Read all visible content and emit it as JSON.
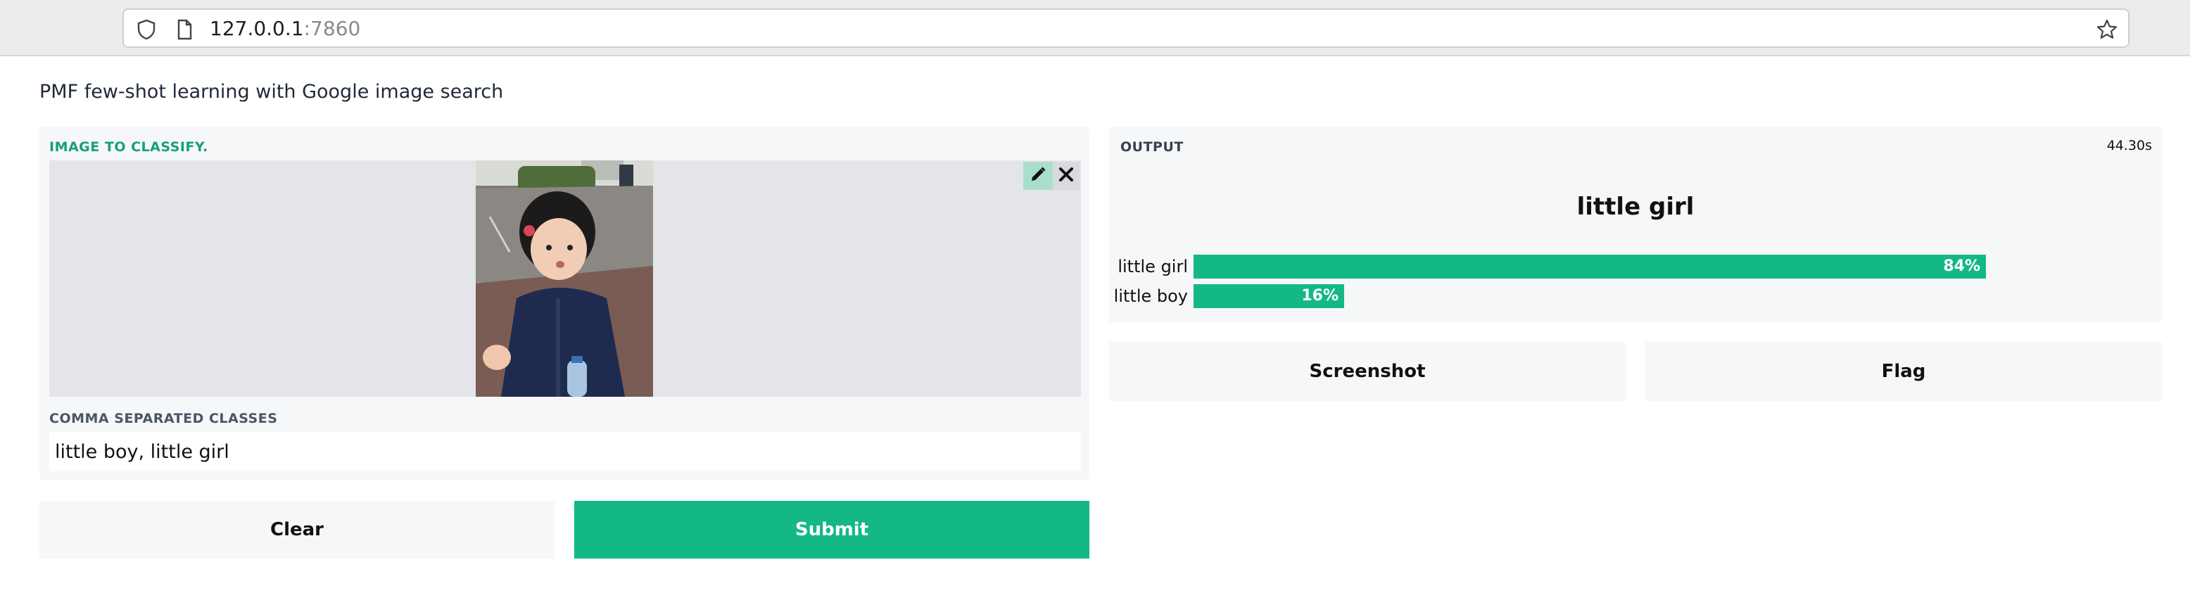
{
  "browser": {
    "url_host": "127.0.0.1",
    "url_port": ":7860",
    "icons": [
      "shield-icon",
      "page-icon",
      "star-icon"
    ]
  },
  "page": {
    "title": "PMF few-shot learning with Google image search"
  },
  "input_panel": {
    "image_label": "IMAGE TO CLASSIFY.",
    "image_alt": "uploaded photo of a child",
    "edit_icon": "pencil-icon",
    "close_icon": "close-icon",
    "classes_label": "COMMA SEPARATED CLASSES",
    "classes_value": "little boy, little girl"
  },
  "actions": {
    "clear_label": "Clear",
    "submit_label": "Submit"
  },
  "output_panel": {
    "label": "OUTPUT",
    "timer": "44.30s",
    "top_label": "little girl",
    "confidences": [
      {
        "name": "little girl",
        "value": 0.84,
        "pct": "84%"
      },
      {
        "name": "little boy",
        "value": 0.16,
        "pct": "16%"
      }
    ]
  },
  "output_actions": {
    "screenshot_label": "Screenshot",
    "flag_label": "Flag"
  },
  "colors": {
    "accent": "#14b884",
    "label_green": "#15a079",
    "panel_bg": "#f6f7f9"
  }
}
